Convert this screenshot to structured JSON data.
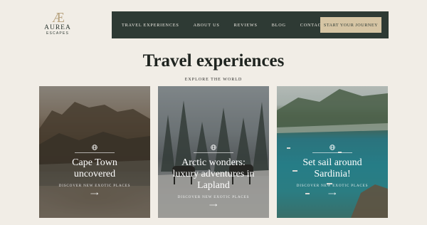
{
  "brand": {
    "mark": "Æ",
    "name": "AUREA",
    "tagline": "ESCAPES"
  },
  "nav": {
    "items": [
      "TRAVEL EXPERIENCES",
      "ABOUT US",
      "REVIEWS",
      "BLOG",
      "CONTACT"
    ],
    "cta": "START YOUR JOURNEY"
  },
  "hero": {
    "title": "Travel experiences",
    "subtitle": "EXPLORE THE WORLD"
  },
  "cards": [
    {
      "title_line1": "Cape Town",
      "title_line2": "uncovered",
      "title_line3": "",
      "link": "DISCOVER NEW EXOTIC PLACES"
    },
    {
      "title_line1": "Arctic wonders:",
      "title_line2": "luxury adventures in",
      "title_line3": "Lapland",
      "link": "DISCOVER NEW EXOTIC PLACES"
    },
    {
      "title_line1": "Set sail around",
      "title_line2": "Sardinia!",
      "title_line3": "",
      "link": "DISCOVER NEW EXOTIC PLACES"
    }
  ],
  "colors": {
    "background": "#f1ede6",
    "nav": "#2e3a34",
    "cta": "#d6c5a4",
    "accent": "#b7a27e"
  },
  "icons": {
    "card_icon": "globe-icon",
    "card_arrow": "arrow-right-icon"
  }
}
